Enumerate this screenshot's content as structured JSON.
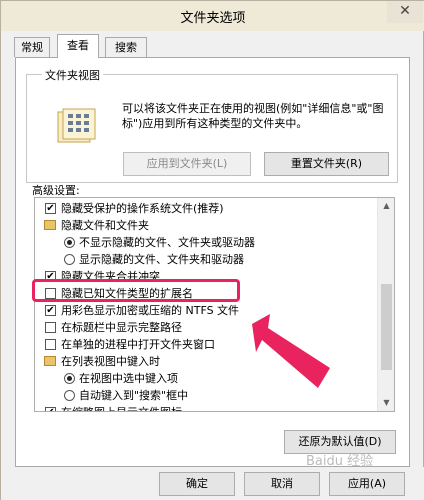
{
  "window": {
    "title": "文件夹选项",
    "close_glyph": "✕"
  },
  "tabs": [
    {
      "label": "常规"
    },
    {
      "label": "查看"
    },
    {
      "label": "搜索"
    }
  ],
  "folder_view": {
    "group_title": "文件夹视图",
    "description": "可以将该文件夹正在使用的视图(例如\"详细信息\"或\"图标\")应用到所有这种类型的文件夹中。",
    "apply_button": "应用到文件夹(L)",
    "reset_button": "重置文件夹(R)"
  },
  "advanced": {
    "label": "高级设置:",
    "items": [
      {
        "type": "checkbox",
        "checked": true,
        "label": "隐藏受保护的操作系统文件(推荐)"
      },
      {
        "type": "folder",
        "label": "隐藏文件和文件夹"
      },
      {
        "type": "radio",
        "checked": true,
        "label": "不显示隐藏的文件、文件夹或驱动器"
      },
      {
        "type": "radio",
        "checked": false,
        "label": "显示隐藏的文件、文件夹和驱动器"
      },
      {
        "type": "checkbox",
        "checked": true,
        "label": "隐藏文件夹合并冲突"
      },
      {
        "type": "checkbox",
        "checked": false,
        "label": "隐藏已知文件类型的扩展名"
      },
      {
        "type": "checkbox",
        "checked": true,
        "label": "用彩色显示加密或压缩的 NTFS 文件"
      },
      {
        "type": "checkbox",
        "checked": false,
        "label": "在标题栏中显示完整路径"
      },
      {
        "type": "checkbox",
        "checked": false,
        "label": "在单独的进程中打开文件夹窗口"
      },
      {
        "type": "folder",
        "label": "在列表视图中键入时"
      },
      {
        "type": "radio",
        "checked": true,
        "label": "在视图中选中键入项"
      },
      {
        "type": "radio",
        "checked": false,
        "label": "自动键入到\"搜索\"框中"
      },
      {
        "type": "checkbox",
        "checked": true,
        "label": "在缩略图上显示文件图标"
      }
    ],
    "restore_button": "还原为默认值(D)"
  },
  "footer": {
    "ok": "确定",
    "cancel": "取消",
    "apply": "应用(A)"
  },
  "annotation": {
    "color": "#e9235e"
  },
  "watermark": "Baidu 经验"
}
